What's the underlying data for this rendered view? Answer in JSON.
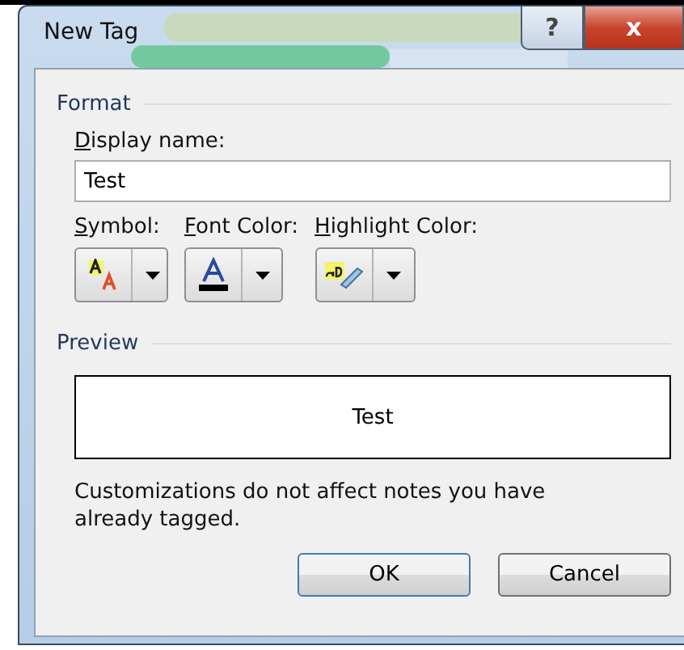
{
  "window": {
    "title": "New Tag",
    "help_glyph": "?",
    "close_glyph": "x"
  },
  "format": {
    "legend": "Format",
    "display_name": {
      "label": "Display name:",
      "underline_first": true,
      "value": "Test"
    },
    "pickers": [
      {
        "kind": "symbol",
        "label": "Symbol:",
        "underline_first": true
      },
      {
        "kind": "font-color",
        "label": "Font Color:",
        "underline_first": true
      },
      {
        "kind": "highlight",
        "label": "Highlight Color:",
        "underline_first": true
      }
    ]
  },
  "preview": {
    "legend": "Preview",
    "text": "Test"
  },
  "note": "Customizations do not affect notes you have already tagged.",
  "buttons": [
    {
      "label": "OK",
      "default": true
    },
    {
      "label": "Cancel",
      "default": false
    }
  ]
}
